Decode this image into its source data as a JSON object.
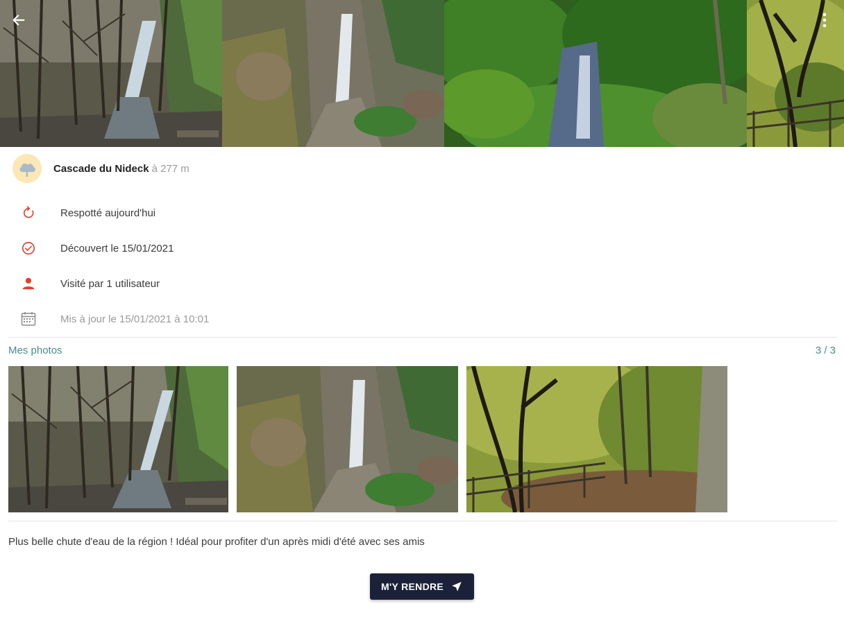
{
  "place": {
    "name": "Cascade du Nideck",
    "distance": "à 277 m"
  },
  "info": {
    "respotted": "Respotté aujourd'hui",
    "discovered": "Découvert le 15/01/2021",
    "visited": "Visité par 1 utilisateur",
    "updated": "Mis à jour le 15/01/2021 à 10:01"
  },
  "photos": {
    "title": "Mes photos",
    "count": "3 / 3"
  },
  "description": "Plus belle chute d'eau de la région ! Idéal pour profiter d'un après midi d'été avec ses amis",
  "action": {
    "go_label": "M'Y RENDRE"
  },
  "colors": {
    "accent_red": "#e0412e",
    "button_bg": "#1b2138",
    "link_teal": "#4a8a8e"
  },
  "icons": {
    "back": "arrow-left-icon",
    "more": "more-vertical-icon",
    "avatar": "cloud-icon",
    "respotted": "refresh-icon",
    "discovered": "check-circle-icon",
    "visited": "person-icon",
    "updated": "calendar-icon",
    "go": "navigation-arrow-icon"
  }
}
